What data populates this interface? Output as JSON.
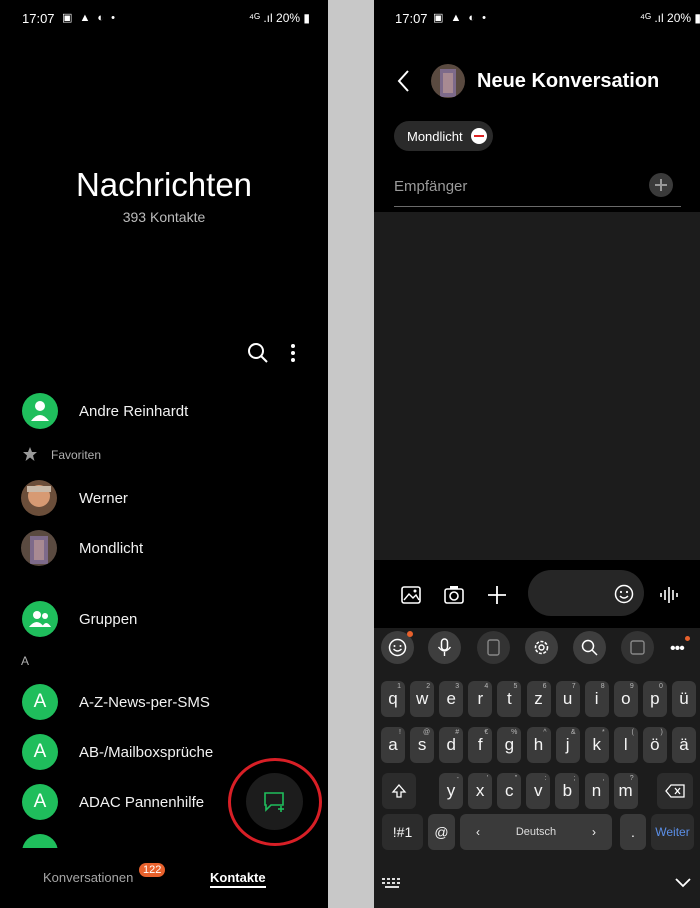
{
  "status": {
    "time": "17:07",
    "icons_left": "▣ ▲ ◐ •",
    "battery": "20%",
    "net": "⁴ᴳ .ıl"
  },
  "contacts": {
    "title": "Nachrichten",
    "subtitle": "393 Kontakte",
    "me": "Andre Reinhardt",
    "favorites_label": "Favoriten",
    "favorites": [
      "Werner",
      "Mondlicht"
    ],
    "groups": "Gruppen",
    "section_a": "A",
    "list": [
      "A-Z-News-per-SMS",
      "AB-/Mailboxsprüche",
      "ADAC Pannenhilfe"
    ],
    "letter": "A"
  },
  "tabs": {
    "conversations": "Konversationen",
    "badge": "122",
    "contacts": "Kontakte"
  },
  "conversation": {
    "title": "Neue Konversation",
    "chip": "Mondlicht",
    "recipient_placeholder": "Empfänger"
  },
  "keyboard": {
    "row1": [
      [
        "q",
        "1"
      ],
      [
        "w",
        "2"
      ],
      [
        "e",
        "3"
      ],
      [
        "r",
        "4"
      ],
      [
        "t",
        "5"
      ],
      [
        "z",
        "6"
      ],
      [
        "u",
        "7"
      ],
      [
        "i",
        "8"
      ],
      [
        "o",
        "9"
      ],
      [
        "p",
        "0"
      ],
      [
        "ü",
        ""
      ]
    ],
    "row2": [
      [
        "a",
        "!"
      ],
      [
        "s",
        "@"
      ],
      [
        "d",
        "#"
      ],
      [
        "f",
        "€"
      ],
      [
        "g",
        "%"
      ],
      [
        "h",
        "^"
      ],
      [
        "j",
        "&"
      ],
      [
        "k",
        "*"
      ],
      [
        "l",
        "("
      ],
      [
        "ö",
        ")"
      ],
      [
        "ä",
        ""
      ]
    ],
    "row3": [
      [
        "y",
        "-"
      ],
      [
        "x",
        "'"
      ],
      [
        "c",
        "\""
      ],
      [
        "v",
        ":"
      ],
      [
        "b",
        ";"
      ],
      [
        "n",
        ","
      ],
      [
        "m",
        "?"
      ]
    ],
    "sym": "!#1",
    "at": "@",
    "lang": "Deutsch",
    "dot": ".",
    "next": "Weiter"
  },
  "colors": {
    "accent_green": "#1fbe5c",
    "badge_orange": "#e8612c",
    "annotation_red": "#d81f26"
  }
}
